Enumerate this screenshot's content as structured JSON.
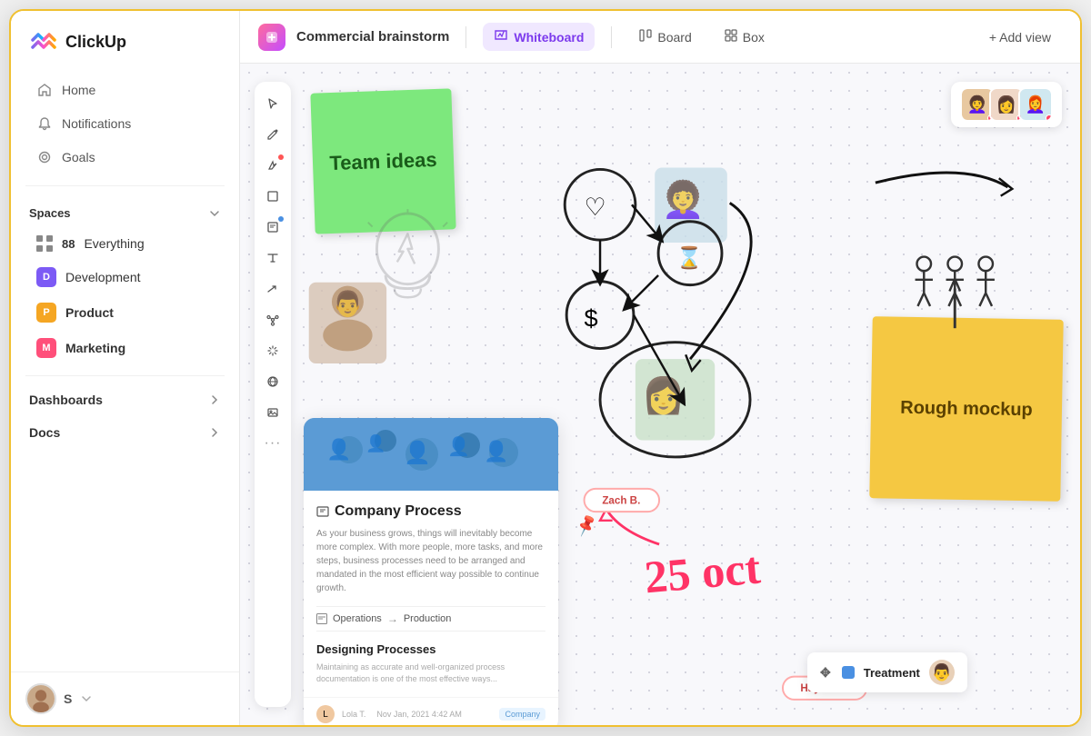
{
  "app": {
    "name": "ClickUp"
  },
  "sidebar": {
    "nav_items": [
      {
        "id": "home",
        "label": "Home",
        "icon": "home"
      },
      {
        "id": "notifications",
        "label": "Notifications",
        "icon": "bell"
      },
      {
        "id": "goals",
        "label": "Goals",
        "icon": "target"
      }
    ],
    "spaces_label": "Spaces",
    "spaces": [
      {
        "id": "everything",
        "label": "Everything",
        "count": "88",
        "icon": "grid"
      },
      {
        "id": "development",
        "label": "Development",
        "icon": "D",
        "color": "#7c5af5"
      },
      {
        "id": "product",
        "label": "Product",
        "icon": "P",
        "color": "#f5a623"
      },
      {
        "id": "marketing",
        "label": "Marketing",
        "icon": "M",
        "color": "#ff4f7a"
      }
    ],
    "dashboards_label": "Dashboards",
    "docs_label": "Docs",
    "user_initial": "S"
  },
  "header": {
    "breadcrumb_title": "Commercial brainstorm",
    "tabs": [
      {
        "id": "whiteboard",
        "label": "Whiteboard",
        "icon": "✏️",
        "active": true
      },
      {
        "id": "board",
        "label": "Board",
        "icon": "▦",
        "active": false
      },
      {
        "id": "box",
        "label": "Box",
        "icon": "⊞",
        "active": false
      }
    ],
    "add_view_label": "+ Add view"
  },
  "whiteboard": {
    "sticky_green_text": "Team ideas",
    "sticky_yellow_text": "Rough mockup",
    "company_card": {
      "title": "Company Process",
      "description": "As your business grows, things will inevitably become more complex. With more people, more tasks, and more steps, business processes need to be arranged and mandated in the most efficient way possible to continue growth.",
      "flow_from": "Operations",
      "flow_to": "Production",
      "sub_title": "Designing Processes",
      "sub_text": "Maintaining as accurate and well-organized process documentation is one of the most effective ways...",
      "author": "Lola T.",
      "date": "Nov Jan, 2021 4:42 AM",
      "tag": "Company"
    },
    "labels": {
      "zach": "Zach B.",
      "haylee": "Haylee B."
    },
    "treatment_label": "Treatment",
    "date_annotation": "25 oct",
    "toolbar_tools": [
      "cursor",
      "pencil-plus",
      "pen",
      "square",
      "note",
      "text",
      "arrow",
      "network",
      "sparkle",
      "globe",
      "image",
      "more"
    ]
  }
}
